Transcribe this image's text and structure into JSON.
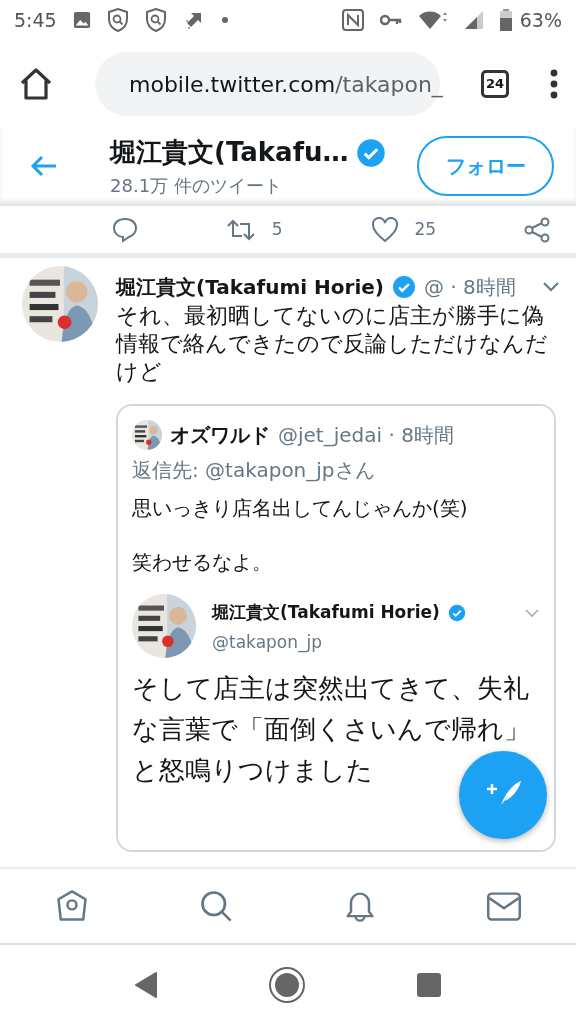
{
  "status_bar": {
    "time": "5:45",
    "battery": "63%"
  },
  "browser": {
    "url_host": "mobile.twitter.com",
    "url_path": "/takapon_",
    "tab_count": "24"
  },
  "header": {
    "name": "堀江貴文(Takafu…",
    "verified": true,
    "tweet_count": "28.1万 件のツイート",
    "follow_button": "フォロー"
  },
  "actions": {
    "retweets": "5",
    "likes": "25"
  },
  "tweet": {
    "name": "堀江貴文(Takafumi Horie)",
    "verified": true,
    "handle": "@",
    "time": "· 8時間",
    "text": "それ、最初晒してないのに店主が勝手に偽情報で絡んできたので反論しただけなんだけど",
    "quote": {
      "name": "オズワルド",
      "handle": "@jet_jedai",
      "time": "· 8時間",
      "reply_to": "返信先: @takapon_jpさん",
      "paragraphs": [
        "思いっきり店名出してんじゃんか(笑)",
        "笑わせるなよ。"
      ],
      "nested": {
        "name": "堀江貴文(Takafumi Horie)",
        "verified": true,
        "handle": "@takapon_jp",
        "text": "そして店主は突然出てきて、失礼な言葉で「面倒くさいんで帰れ」と怒鳴りつけました"
      }
    }
  },
  "bottom_nav": [
    {
      "kind": "home"
    },
    {
      "kind": "search"
    },
    {
      "kind": "notifications"
    },
    {
      "kind": "messages"
    }
  ]
}
